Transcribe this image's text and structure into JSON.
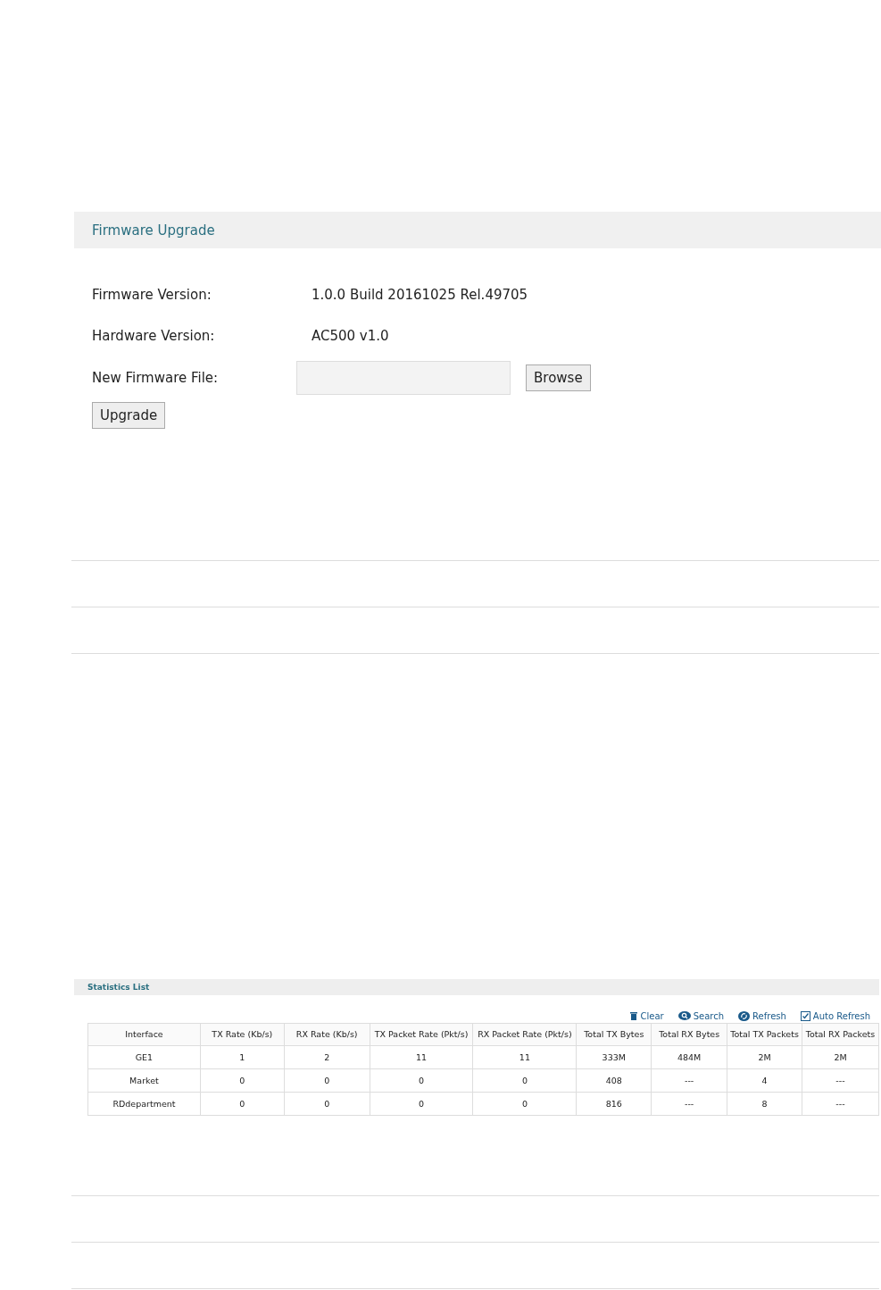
{
  "firmware": {
    "title": "Firmware Upgrade",
    "fields": [
      {
        "label": "Firmware Version:",
        "value": "1.0.0 Build 20161025 Rel.49705"
      },
      {
        "label": "Hardware Version:",
        "value": "AC500 v1.0"
      }
    ],
    "file": {
      "label": "New Firmware File:",
      "browse": "Browse"
    },
    "upgrade": "Upgrade"
  },
  "statistics": {
    "title": "Statistics List",
    "toolbar": [
      {
        "kind": "clear",
        "label": "Clear"
      },
      {
        "kind": "search",
        "label": "Search"
      },
      {
        "kind": "refresh",
        "label": "Refresh"
      },
      {
        "kind": "checkbox",
        "label": "Auto Refresh",
        "checked": true
      }
    ],
    "columns": [
      "Interface",
      "TX Rate (Kb/s)",
      "RX Rate (Kb/s)",
      "TX Packet Rate (Pkt/s)",
      "RX Packet Rate (Pkt/s)",
      "Total TX Bytes",
      "Total RX Bytes",
      "Total TX Packets",
      "Total RX Packets"
    ],
    "rows": [
      [
        "GE1",
        "1",
        "2",
        "11",
        "11",
        "333M",
        "484M",
        "2M",
        "2M"
      ],
      [
        "Market",
        "0",
        "0",
        "0",
        "0",
        "408",
        "---",
        "4",
        "---"
      ],
      [
        "RDdepartment",
        "0",
        "0",
        "0",
        "0",
        "816",
        "---",
        "8",
        "---"
      ]
    ]
  }
}
